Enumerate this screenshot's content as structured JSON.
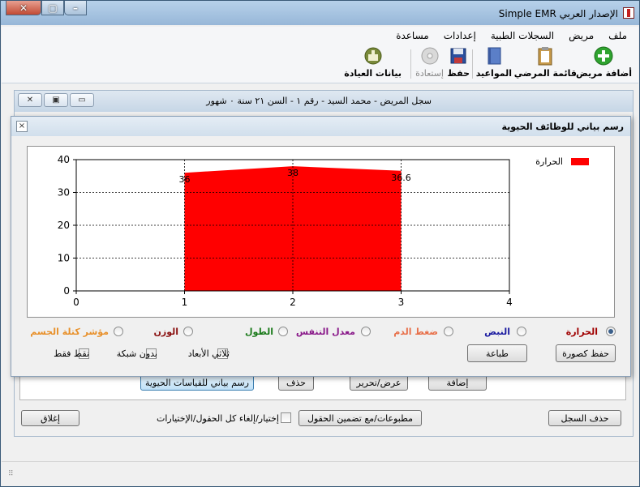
{
  "app": {
    "title": "الإصدار العربي Simple EMR",
    "menu": [
      "ملف",
      "مريض",
      "السجلات الطبية",
      "إعدادات",
      "مساعدة"
    ],
    "toolbar": {
      "add_patient": "أضافة مريض",
      "patient_list": "قائمة المرضي",
      "appointments": "المواعيد",
      "save": "حفظ",
      "restore": "إستعادة",
      "clinic_data": "بيانات العيادة"
    }
  },
  "record_window": {
    "title": "سجل المريض - محمد السيد - رقم ١ - السن ٢١ سنة ٠ شهور",
    "buttons": {
      "vitals_chart": "رسم بياني للقياسات الحيوية",
      "delete": "حذف",
      "view_edit": "عرض/تحرير",
      "add": "إضافة",
      "print_with_fields": "مطبوعات/مع تضمين الحقول",
      "select_all": "إختيار/إلغاء كل الحقول/الإختيارات",
      "delete_record": "حذف السجل",
      "close": "إغلاق"
    }
  },
  "chart_dialog": {
    "title": "رسم بياني للوظائف الحيوية",
    "close_glyph": "×",
    "radios": [
      {
        "label": "الحرارة",
        "color": "#a00000",
        "checked": true
      },
      {
        "label": "النبض",
        "color": "#1a1aa0",
        "checked": false
      },
      {
        "label": "ضغط الدم",
        "color": "#e8704a",
        "checked": false
      },
      {
        "label": "معدل التنفس",
        "color": "#8a1a8a",
        "checked": false
      },
      {
        "label": "الطول",
        "color": "#1a7a1a",
        "checked": false
      },
      {
        "label": "الوزن",
        "color": "#8a1010",
        "checked": false
      },
      {
        "label": "مؤشر كتلة الجسم",
        "color": "#e8902a",
        "checked": false
      }
    ],
    "checks": [
      "ثلاثي الأبعاد",
      "بدون شبكة",
      "نقط فقط"
    ],
    "save_image": "حفظ كصورة",
    "print": "طباعة"
  },
  "chart_data": {
    "type": "area",
    "x": [
      1,
      2,
      3
    ],
    "series": [
      {
        "name": "الحرارة",
        "values": [
          36,
          38,
          36.6
        ],
        "labels": [
          "36",
          "38",
          "36.6"
        ],
        "color": "#ff0000"
      }
    ],
    "xlim": [
      0,
      4
    ],
    "ylim": [
      0,
      40
    ],
    "xticks": [
      0,
      1,
      2,
      3,
      4
    ],
    "yticks": [
      0,
      10,
      20,
      30,
      40
    ],
    "grid": true,
    "legend": "top-right"
  },
  "colors": {
    "accent": "#ff0000",
    "ok_icon": "#2fa32f"
  }
}
